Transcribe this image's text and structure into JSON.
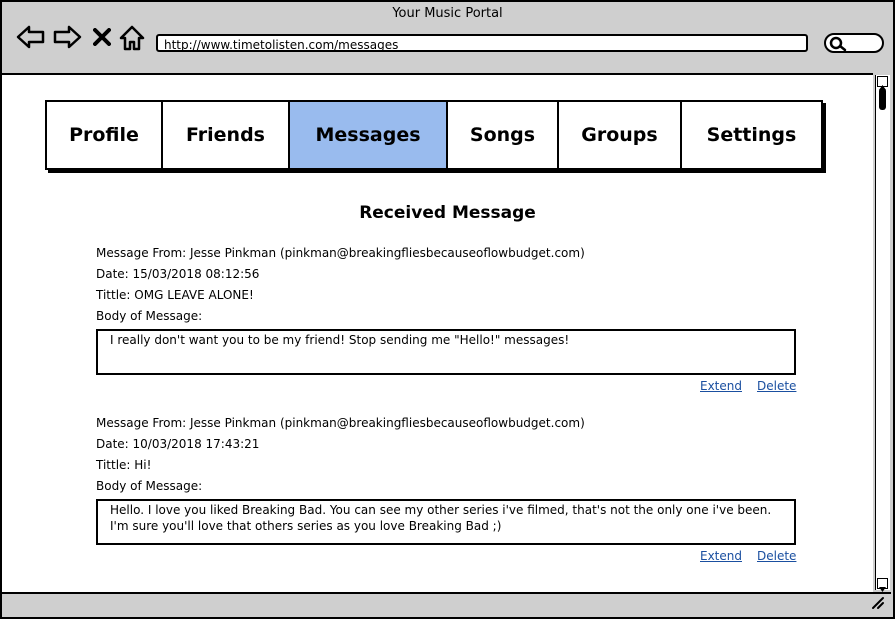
{
  "window": {
    "title": "Your Music Portal"
  },
  "toolbar": {
    "url": "http://www.timetolisten.com/messages",
    "icons": [
      "back-arrow-icon",
      "forward-arrow-icon",
      "close-x-icon",
      "home-icon",
      "search-icon"
    ]
  },
  "tabs": [
    {
      "label": "Profile",
      "active": false
    },
    {
      "label": "Friends",
      "active": false
    },
    {
      "label": "Messages",
      "active": true
    },
    {
      "label": "Songs",
      "active": false
    },
    {
      "label": "Groups",
      "active": false
    },
    {
      "label": "Settings",
      "active": false
    }
  ],
  "colors": {
    "active_tab": "#99bbee",
    "link": "#1a4fa0",
    "chrome": "#cfcfcf"
  },
  "page": {
    "title": "Received Message"
  },
  "messages": [
    {
      "from": "Message From: Jesse Pinkman (pinkman@breakingfliesbecauseoflowbudget.com)",
      "date": "Date: 15/03/2018 08:12:56",
      "title": "Tittle: OMG LEAVE ALONE!",
      "body_label": "Body of Message:",
      "body": "I really don't want you to be my friend! Stop sending me \"Hello!\" messages!",
      "extend": "Extend",
      "delete": "Delete"
    },
    {
      "from": "Message From: Jesse Pinkman (pinkman@breakingfliesbecauseoflowbudget.com)",
      "date": "Date: 10/03/2018 17:43:21",
      "title": "Tittle: Hi!",
      "body_label": "Body of Message:",
      "body": "Hello. I love you liked Breaking Bad. You can see my other series i've filmed, that's not the only one i've been. I'm sure you'll love that others series as you love Breaking Bad ;)",
      "extend": "Extend",
      "delete": "Delete"
    }
  ]
}
